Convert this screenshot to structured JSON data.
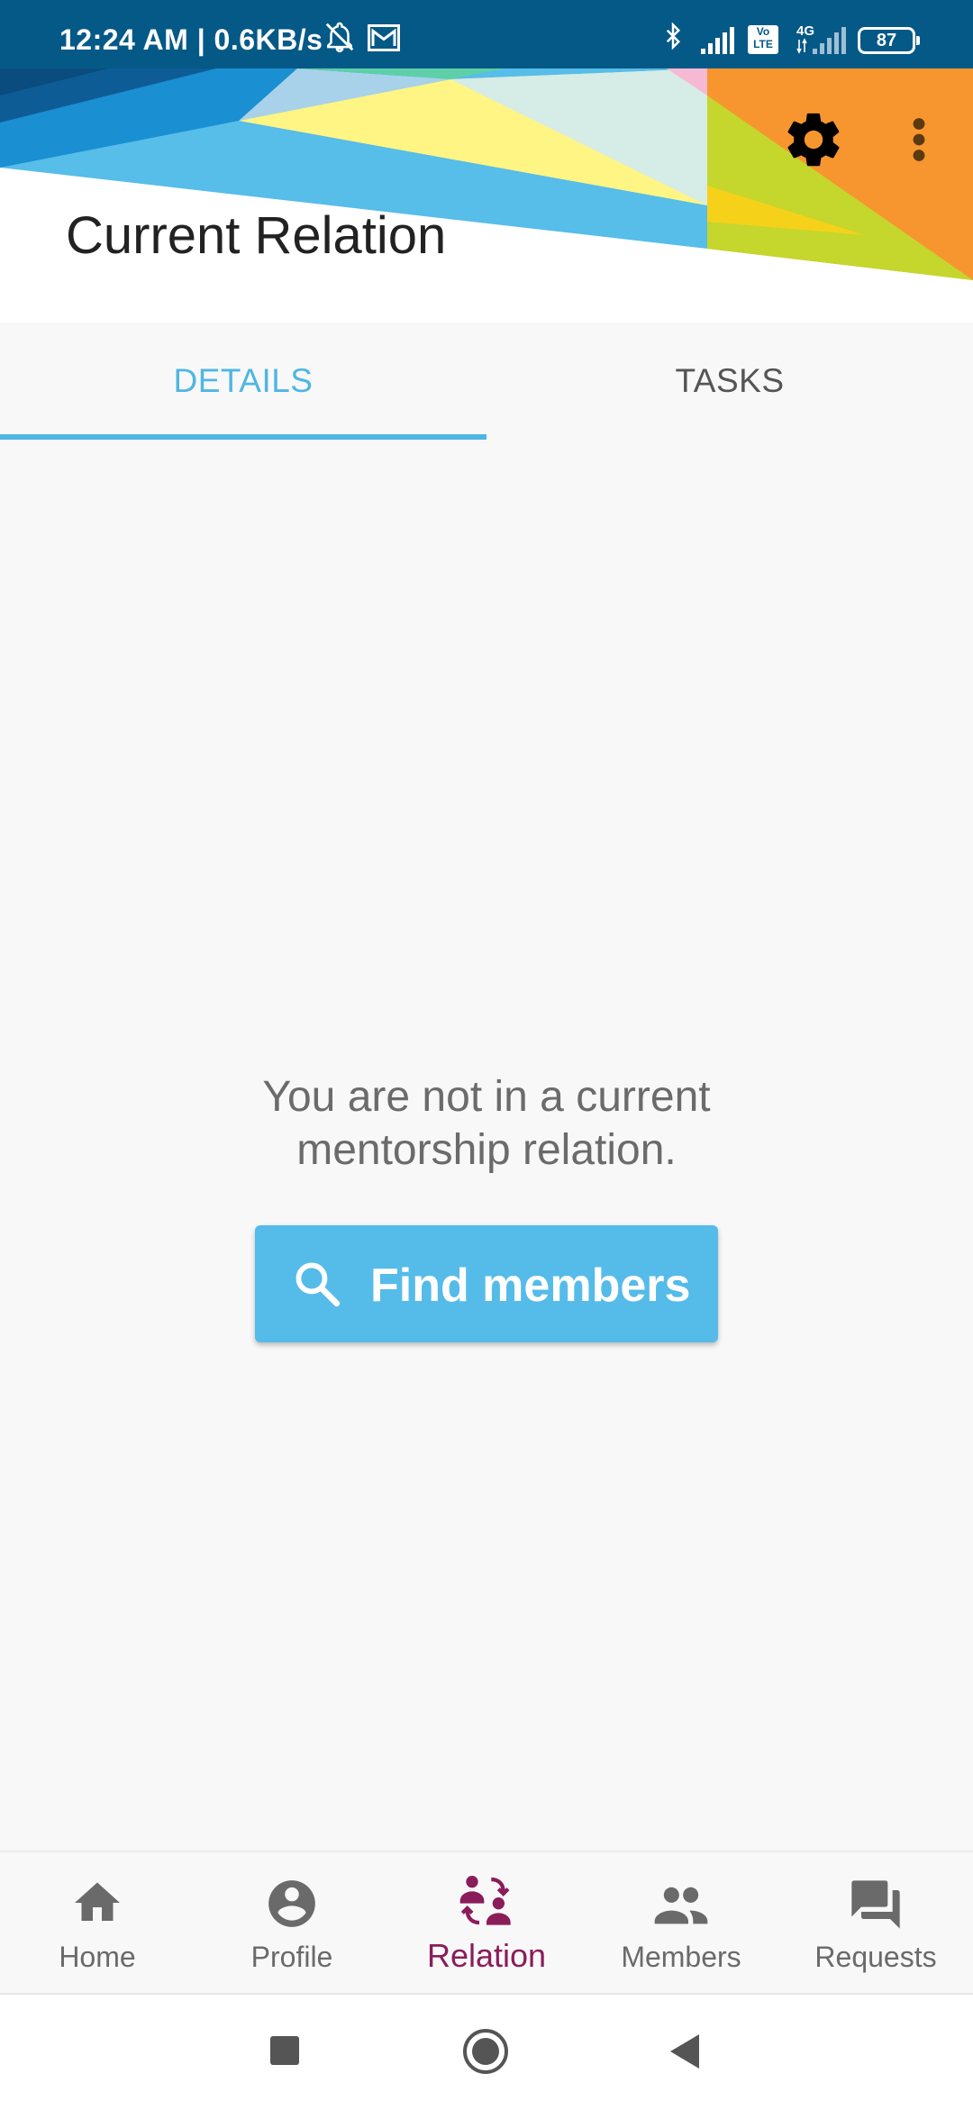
{
  "status_bar": {
    "time": "12:24 AM | 0.6KB/s",
    "battery": "87",
    "network": "4G",
    "volte": "Vo LTE",
    "icons": [
      "mute-icon",
      "mail-icon",
      "bluetooth-icon",
      "signal-icon",
      "volte-icon",
      "signal-4g-icon",
      "battery-icon"
    ]
  },
  "header": {
    "title": "Current Relation",
    "settings_icon": "gear-icon",
    "menu_icon": "more-vert-icon"
  },
  "tabs": [
    {
      "label": "DETAILS",
      "selected": true
    },
    {
      "label": "TASKS",
      "selected": false
    }
  ],
  "empty_state": {
    "line1": "You are not in a current",
    "line2": "mentorship relation.",
    "button_label": "Find members",
    "button_icon": "search-icon"
  },
  "bottom_nav": [
    {
      "label": "Home",
      "icon": "home-icon",
      "active": false
    },
    {
      "label": "Profile",
      "icon": "account-circle-icon",
      "active": false
    },
    {
      "label": "Relation",
      "icon": "relation-icon",
      "active": true
    },
    {
      "label": "Members",
      "icon": "people-icon",
      "active": false
    },
    {
      "label": "Requests",
      "icon": "forum-icon",
      "active": false
    }
  ],
  "colors": {
    "status_bar": "#045987",
    "accent": "#4fb6e3",
    "button": "#55bbe9",
    "active_nav": "#8a1c5a",
    "banner_orange": "#f7962f",
    "banner_lime": "#c5d62c",
    "banner_yellow": "#fff584"
  },
  "system_nav": [
    "recents-button",
    "home-button",
    "back-button"
  ]
}
